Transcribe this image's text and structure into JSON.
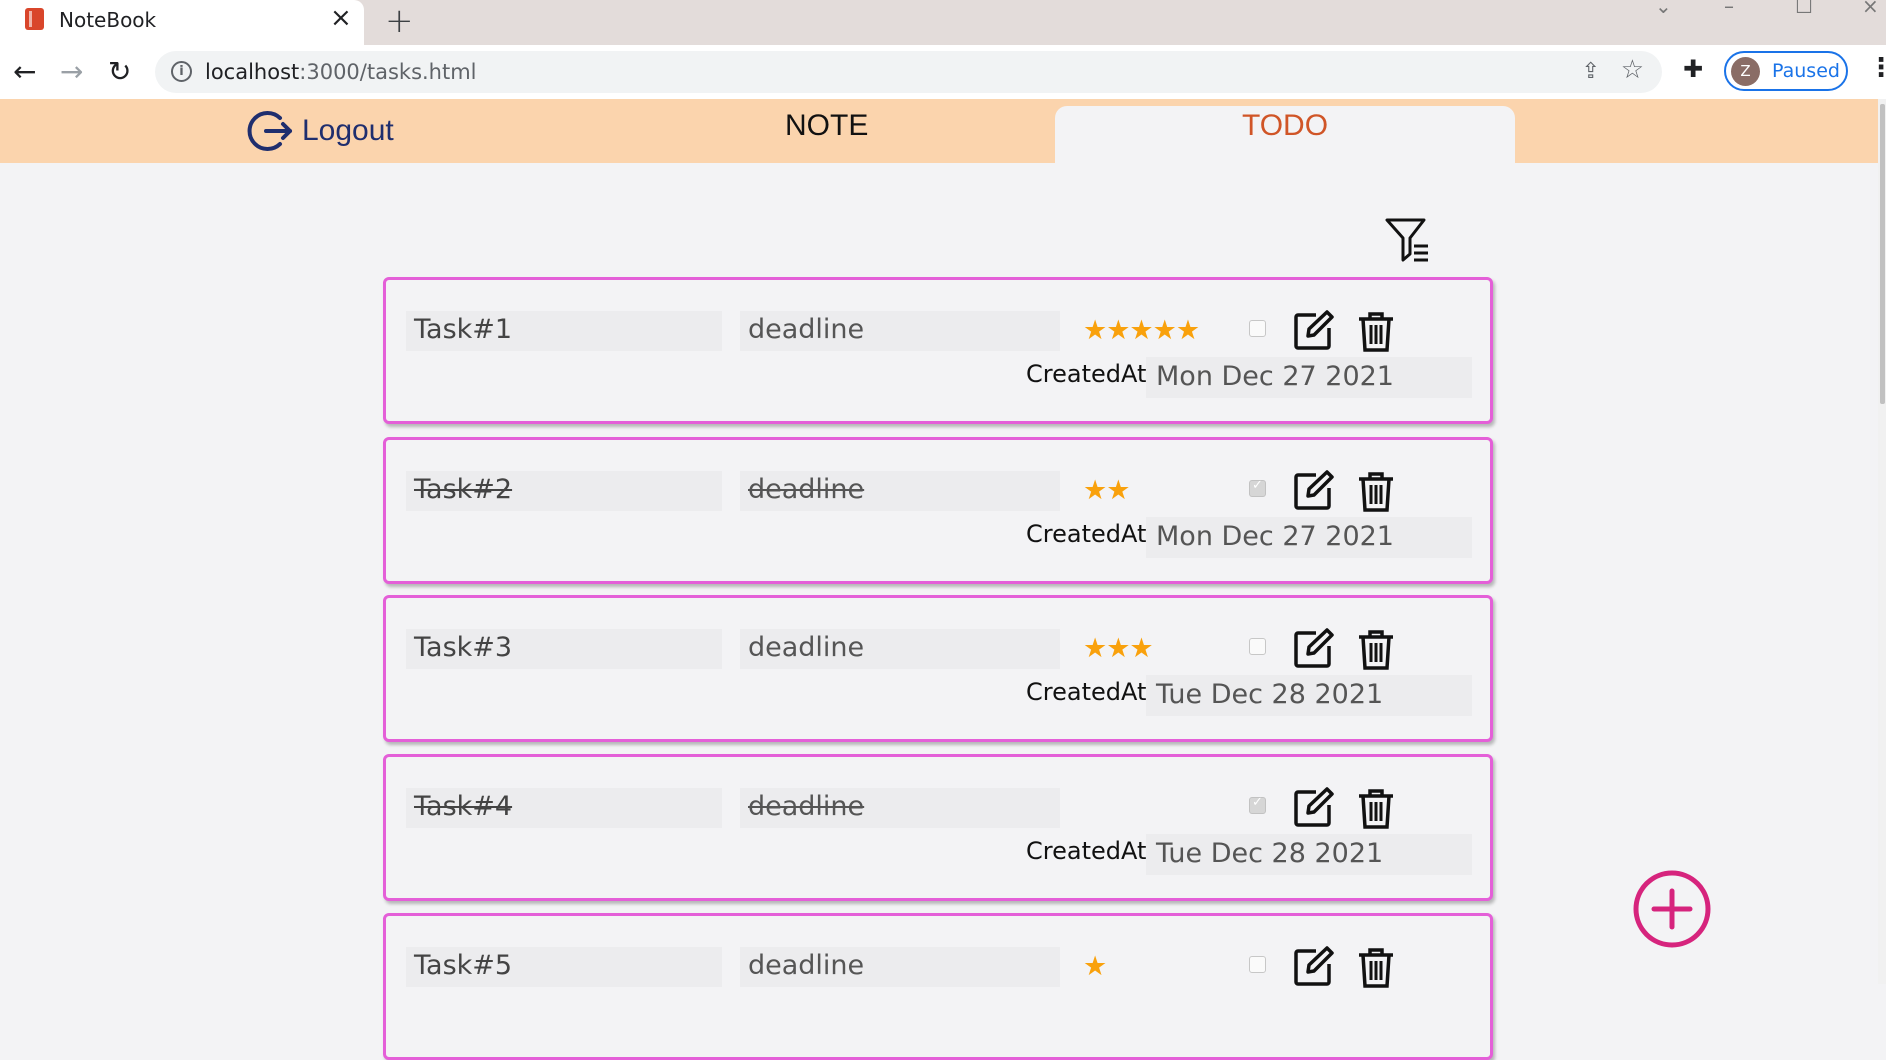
{
  "browser": {
    "tab_title": "NoteBook",
    "url_host": "localhost",
    "url_path": ":3000/tasks.html",
    "profile_initial": "Z",
    "profile_status": "Paused"
  },
  "header": {
    "logout_label": "Logout",
    "nav_note": "NOTE",
    "nav_todo": "TODO",
    "active_tab": "TODO"
  },
  "colors": {
    "header_bg": "#fbd4ad",
    "card_border": "#e45fd8",
    "star": "#f9a10c",
    "todo_active": "#d05527",
    "add_button": "#d6247d"
  },
  "tasks": [
    {
      "name": "Task#1",
      "deadline": "deadline",
      "stars": "★★★★★",
      "rating": 5,
      "done": false,
      "created_label": "CreatedAt:",
      "created_at": "Mon Dec 27 2021"
    },
    {
      "name": "Task#2",
      "deadline": "deadline",
      "stars": "★★",
      "rating": 2,
      "done": true,
      "created_label": "CreatedAt:",
      "created_at": "Mon Dec 27 2021"
    },
    {
      "name": "Task#3",
      "deadline": "deadline",
      "stars": "★★★",
      "rating": 3,
      "done": false,
      "created_label": "CreatedAt:",
      "created_at": "Tue Dec 28 2021"
    },
    {
      "name": "Task#4",
      "deadline": "deadline",
      "stars": "",
      "rating": 0,
      "done": true,
      "created_label": "CreatedAt:",
      "created_at": "Tue Dec 28 2021"
    },
    {
      "name": "Task#5",
      "deadline": "deadline",
      "stars": "★",
      "rating": 1,
      "done": false,
      "created_label": "CreatedAt:",
      "created_at": ""
    }
  ]
}
